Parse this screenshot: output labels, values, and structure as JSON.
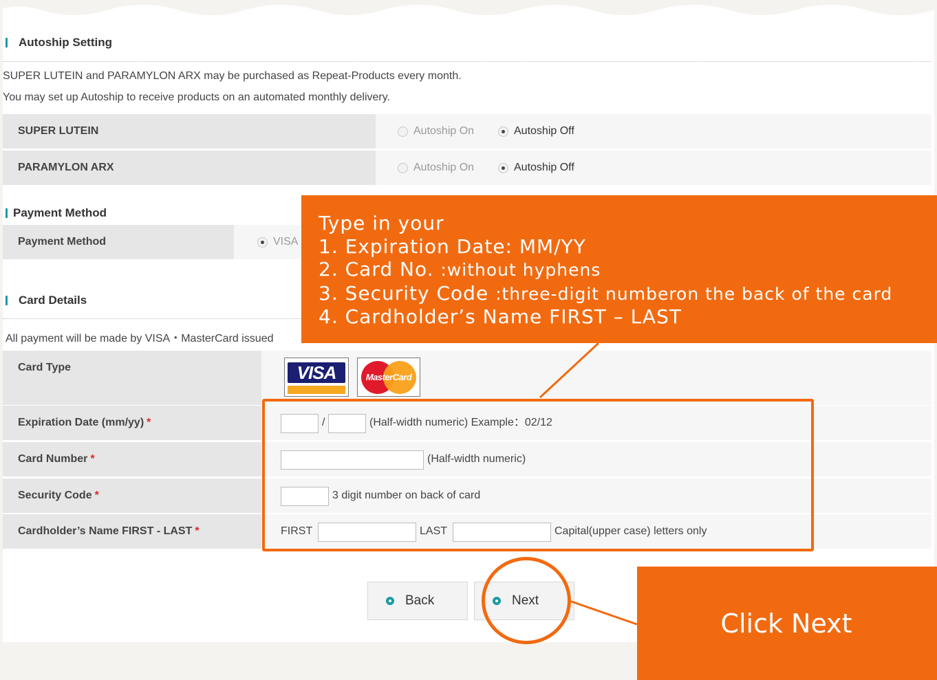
{
  "autoship": {
    "title": "Autoship Setting",
    "desc_line1": "SUPER LUTEIN and PARAMYLON ARX may be purchased as Repeat-Products every month.",
    "desc_line2": "You may set up Autoship to receive products on an automated monthly delivery.",
    "products": [
      {
        "name": "SUPER LUTEIN",
        "on_label": "Autoship On",
        "off_label": "Autoship Off",
        "selected": "off"
      },
      {
        "name": "PARAMYLON ARX",
        "on_label": "Autoship On",
        "off_label": "Autoship Off",
        "selected": "off"
      }
    ]
  },
  "payment": {
    "title": "Payment Method",
    "label": "Payment Method",
    "option": "VISA"
  },
  "card_details": {
    "title": "Card Details",
    "desc": "All payment will be made by VISA・MasterCard issued",
    "card_type_label": "Card Type",
    "card_logos": {
      "visa": "VISA",
      "mastercard": "MasterCard"
    },
    "expiration": {
      "label": "Expiration Date (mm/yy)",
      "separator": "/",
      "hint": "(Half-width numeric) Example：02/12"
    },
    "card_number": {
      "label": "Card Number",
      "hint": "(Half-width numeric)"
    },
    "security_code": {
      "label": "Security Code",
      "hint": "3 digit number on back of card"
    },
    "cardholder": {
      "label": "Cardholder’s Name FIRST - LAST",
      "first_label": "FIRST",
      "last_label": "LAST",
      "hint": "Capital(upper case) letters only"
    },
    "required_mark": "*"
  },
  "buttons": {
    "back": "Back",
    "next": "Next"
  },
  "callouts": {
    "instructions_intro": "Type in your",
    "step1": "1. Expiration Date: MM/YY",
    "step2_main": "2. Card No. ",
    "step2_sub": ":without hyphens",
    "step3_main": "3. Security Code ",
    "step3_sub": ":three-digit numberon the back of the card",
    "step4": "4. Cardholder’s Name FIRST – LAST",
    "click_next": "Click Next"
  },
  "colors": {
    "accent": "#1a9aa5",
    "callout": "#f26a10",
    "required": "#d9262e"
  }
}
